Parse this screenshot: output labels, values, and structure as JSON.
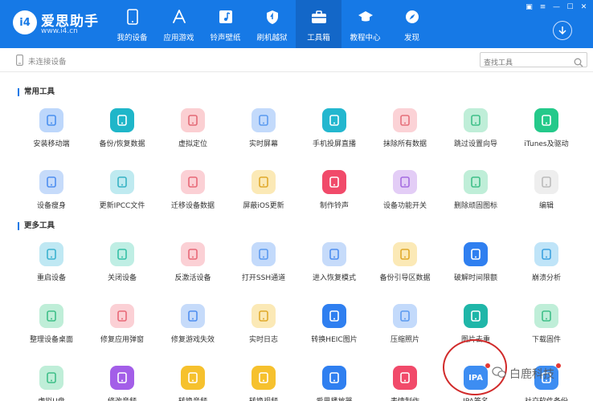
{
  "app": {
    "logo_badge": "i4",
    "name": "爱思助手",
    "url": "www.i4.cn"
  },
  "nav": {
    "items": [
      {
        "label": "我的设备",
        "icon": "phone-icon"
      },
      {
        "label": "应用游戏",
        "icon": "app-store-icon"
      },
      {
        "label": "铃声壁纸",
        "icon": "music-note-icon"
      },
      {
        "label": "刷机越狱",
        "icon": "shield-icon"
      },
      {
        "label": "工具箱",
        "icon": "toolbox-icon"
      },
      {
        "label": "教程中心",
        "icon": "graduation-cap-icon"
      },
      {
        "label": "发现",
        "icon": "compass-icon"
      }
    ],
    "active_index": 4
  },
  "device_status": "未连接设备",
  "search": {
    "placeholder": "查找工具"
  },
  "sections": {
    "common": "常用工具",
    "more": "更多工具"
  },
  "tools_common": [
    {
      "label": "安装移动端",
      "icon": "install-mobile-icon",
      "bg": "#bdd7fb",
      "fg": "#4a90f0"
    },
    {
      "label": "备份/恢复数据",
      "icon": "umbrella-icon",
      "bg": "#1fb6c9",
      "fg": "#ffffff"
    },
    {
      "label": "虚拟定位",
      "icon": "location-pin-icon",
      "bg": "#fbcfd2",
      "fg": "#e36a76"
    },
    {
      "label": "实时屏幕",
      "icon": "screen-image-icon",
      "bg": "#c3dafb",
      "fg": "#5b9af0"
    },
    {
      "label": "手机投屏直播",
      "icon": "play-screen-icon",
      "bg": "#23b7cf",
      "fg": "#ffffff"
    },
    {
      "label": "抹除所有数据",
      "icon": "eraser-icon",
      "bg": "#fbd2d6",
      "fg": "#e56f7a"
    },
    {
      "label": "跳过设置向导",
      "icon": "skip-document-icon",
      "bg": "#bfeed8",
      "fg": "#3fbf88"
    },
    {
      "label": "iTunes及驱动",
      "icon": "itunes-music-icon",
      "bg": "#24c98a",
      "fg": "#ffffff"
    },
    {
      "label": "设备瘦身",
      "icon": "broom-icon",
      "bg": "#c6dbfa",
      "fg": "#4e8ef0"
    },
    {
      "label": "更新IPCC文件",
      "icon": "ipcc-file-icon",
      "bg": "#bfeaf0",
      "fg": "#37b2c4"
    },
    {
      "label": "迁移设备数据",
      "icon": "migrate-data-icon",
      "bg": "#fbd0d5",
      "fg": "#e86877"
    },
    {
      "label": "屏蔽iOS更新",
      "icon": "block-update-icon",
      "bg": "#fbe9b6",
      "fg": "#e0a92b"
    },
    {
      "label": "制作铃声",
      "icon": "ringtone-icon",
      "bg": "#f14a6a",
      "fg": "#ffffff"
    },
    {
      "label": "设备功能开关",
      "icon": "toggle-switch-icon",
      "bg": "#e3cdf6",
      "fg": "#a56ce0"
    },
    {
      "label": "删除顽固图标",
      "icon": "delete-icon-icon",
      "bg": "#bfeed8",
      "fg": "#3fbf88"
    },
    {
      "label": "编辑",
      "icon": "plus-icon",
      "bg": "#eeeeee",
      "fg": "#bbbbbb"
    }
  ],
  "tools_more": [
    {
      "label": "重启设备",
      "icon": "restart-burst-icon",
      "bg": "#bfe8f3",
      "fg": "#3bb2cf"
    },
    {
      "label": "关闭设备",
      "icon": "power-icon",
      "bg": "#bfeee4",
      "fg": "#35c0a6"
    },
    {
      "label": "反激活设备",
      "icon": "deactivate-phone-icon",
      "bg": "#fbd0d5",
      "fg": "#e86877"
    },
    {
      "label": "打开SSH通道",
      "icon": "ssh-terminal-icon",
      "bg": "#c3dafb",
      "fg": "#5b9af0"
    },
    {
      "label": "进入恢复模式",
      "icon": "recovery-phone-icon",
      "bg": "#c6dbfa",
      "fg": "#4e8ef0"
    },
    {
      "label": "备份引导区数据",
      "icon": "backup-boot-icon",
      "bg": "#fbe9b6",
      "fg": "#e0a92b"
    },
    {
      "label": "破解时间限额",
      "icon": "hourglass-icon",
      "bg": "#2f7ff0",
      "fg": "#ffffff"
    },
    {
      "label": "崩溃分析",
      "icon": "crash-report-icon",
      "bg": "#bfe4f8",
      "fg": "#3ca2e0"
    },
    {
      "label": "整理设备桌面",
      "icon": "desktop-grid-icon",
      "bg": "#bfeed8",
      "fg": "#3fbf88"
    },
    {
      "label": "修复应用弹窗",
      "icon": "fix-popup-icon",
      "bg": "#fbd0d5",
      "fg": "#e86877"
    },
    {
      "label": "修复游戏失效",
      "icon": "gamepad-icon",
      "bg": "#c6dbfa",
      "fg": "#4e8ef0"
    },
    {
      "label": "实时日志",
      "icon": "log-document-icon",
      "bg": "#fbe9b6",
      "fg": "#e0a92b"
    },
    {
      "label": "转换HEIC图片",
      "icon": "heic-image-icon",
      "bg": "#2f7ff0",
      "fg": "#ffffff"
    },
    {
      "label": "压缩照片",
      "icon": "compress-photo-icon",
      "bg": "#c3dafb",
      "fg": "#5b9af0"
    },
    {
      "label": "图片去重",
      "icon": "dedupe-image-icon",
      "bg": "#1fb6a8",
      "fg": "#ffffff"
    },
    {
      "label": "下载固件",
      "icon": "firmware-download-icon",
      "bg": "#bfeed8",
      "fg": "#3fbf88"
    },
    {
      "label": "虚拟U盘",
      "icon": "usb-drive-icon",
      "bg": "#bfeed8",
      "fg": "#3fbf88"
    },
    {
      "label": "修改音频",
      "icon": "edit-audio-icon",
      "bg": "#a35ee8",
      "fg": "#ffffff"
    },
    {
      "label": "转换音频",
      "icon": "audio-wave-icon",
      "bg": "#f6c12e",
      "fg": "#ffffff"
    },
    {
      "label": "转换视频",
      "icon": "video-convert-icon",
      "bg": "#f6c12e",
      "fg": "#ffffff"
    },
    {
      "label": "爱思播放器",
      "icon": "player-icon",
      "bg": "#2f7ff0",
      "fg": "#ffffff"
    },
    {
      "label": "表情制作",
      "icon": "emoji-face-icon",
      "bg": "#f14a6a",
      "fg": "#ffffff"
    },
    {
      "label": "IPA签名",
      "icon": "ipa-sign-icon",
      "bg": "#3d8df2",
      "fg": "#ffffff",
      "badge": true,
      "text": "IPA"
    },
    {
      "label": "社交软件备份",
      "icon": "social-chat-icon",
      "bg": "#3d8df2",
      "fg": "#ffffff",
      "badge": true
    }
  ],
  "watermark": "白鹿科技"
}
